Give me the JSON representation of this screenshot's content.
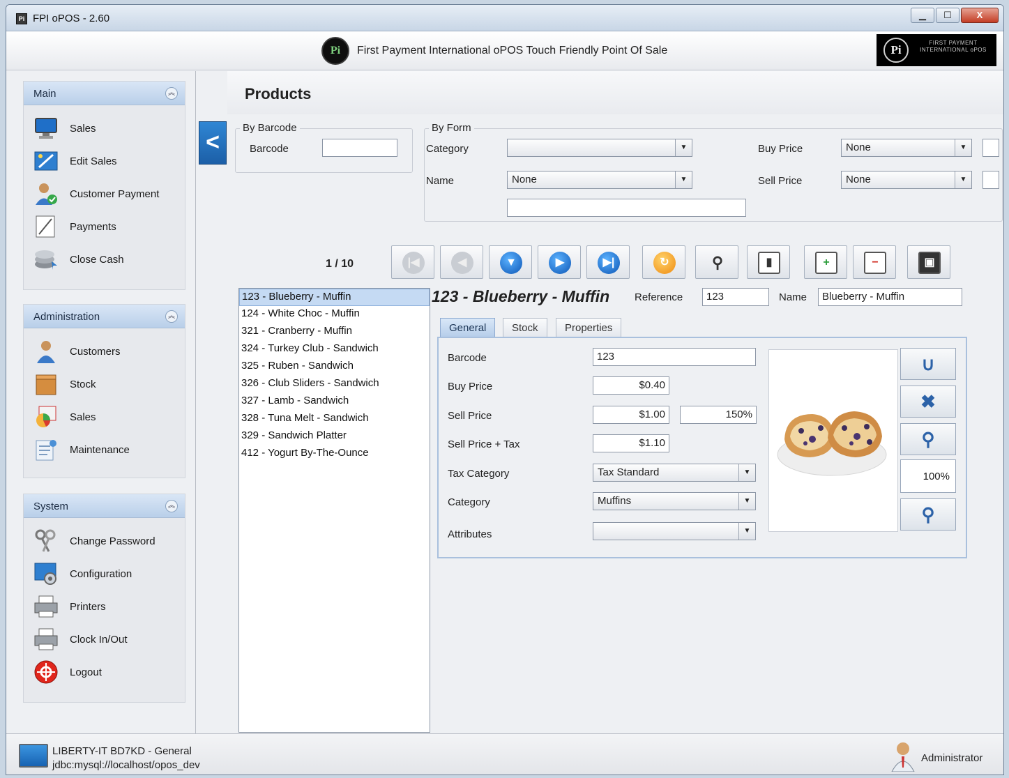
{
  "window": {
    "title": "FPI oPOS - 2.60",
    "icon_label": "Pi",
    "minimize": "▁",
    "maximize": "☐",
    "close": "X"
  },
  "header": {
    "logo_text": "Pi",
    "text": "First Payment International oPOS   Touch Friendly Point Of Sale",
    "brand_logo_text": "FIRST PAYMENT INTERNATIONAL oPOS"
  },
  "sidebar": {
    "main": {
      "title": "Main",
      "items": [
        {
          "label": "Sales",
          "icon": "monitor-icon"
        },
        {
          "label": "Edit Sales",
          "icon": "edit-icon"
        },
        {
          "label": "Customer Payment",
          "icon": "customer-payment-icon"
        },
        {
          "label": "Payments",
          "icon": "payments-icon"
        },
        {
          "label": "Close Cash",
          "icon": "coins-icon"
        }
      ]
    },
    "administration": {
      "title": "Administration",
      "items": [
        {
          "label": "Customers",
          "icon": "person-icon"
        },
        {
          "label": "Stock",
          "icon": "box-icon"
        },
        {
          "label": "Sales",
          "icon": "chart-icon"
        },
        {
          "label": "Maintenance",
          "icon": "maintenance-icon"
        }
      ]
    },
    "system": {
      "title": "System",
      "items": [
        {
          "label": "Change Password",
          "icon": "keys-icon"
        },
        {
          "label": "Configuration",
          "icon": "configuration-icon"
        },
        {
          "label": "Printers",
          "icon": "printer-icon"
        },
        {
          "label": "Clock In/Out",
          "icon": "clock-printer-icon"
        },
        {
          "label": "Logout",
          "icon": "logout-icon"
        }
      ]
    }
  },
  "products": {
    "title": "Products",
    "back_label": "<",
    "by_barcode": {
      "legend": "By Barcode",
      "barcode_label": "Barcode",
      "barcode_value": ""
    },
    "by_form": {
      "legend": "By Form",
      "category_label": "Category",
      "category_value": "",
      "name_label": "Name",
      "name_value": "None",
      "name_text": "",
      "buy_price_label": "Buy Price",
      "buy_price_value": "None",
      "sell_price_label": "Sell Price",
      "sell_price_value": "None"
    },
    "pager": "1 / 10",
    "list": [
      "123 - Blueberry - Muffin",
      "124 - White Choc - Muffin",
      "321 - Cranberry - Muffin",
      "324 - Turkey Club - Sandwich",
      "325 - Ruben - Sandwich",
      "326 - Club Sliders - Sandwich",
      "327 - Lamb - Sandwich",
      "328 - Tuna Melt - Sandwich",
      "329 - Sandwich Platter",
      "412 - Yogurt By-The-Ounce"
    ],
    "detail": {
      "title": "123 - Blueberry - Muffin",
      "reference_label": "Reference",
      "reference_value": "123",
      "name_label": "Name",
      "name_value": "Blueberry - Muffin",
      "tabs": [
        "General",
        "Stock",
        "Properties"
      ],
      "general": {
        "barcode_label": "Barcode",
        "barcode_value": "123",
        "buy_price_label": "Buy Price",
        "buy_price_value": "$0.40",
        "sell_price_label": "Sell Price",
        "sell_price_value": "$1.00",
        "margin_value": "150%",
        "sell_price_tax_label": "Sell Price + Tax",
        "sell_price_tax_value": "$1.10",
        "tax_category_label": "Tax Category",
        "tax_category_value": "Tax Standard",
        "category_label": "Category",
        "category_value": "Muffins",
        "attributes_label": "Attributes",
        "attributes_value": ""
      },
      "zoom": "100%"
    }
  },
  "status": {
    "line1": "LIBERTY-IT BD7KD - General",
    "line2": "jdbc:mysql://localhost/opos_dev",
    "user": "Administrator"
  }
}
